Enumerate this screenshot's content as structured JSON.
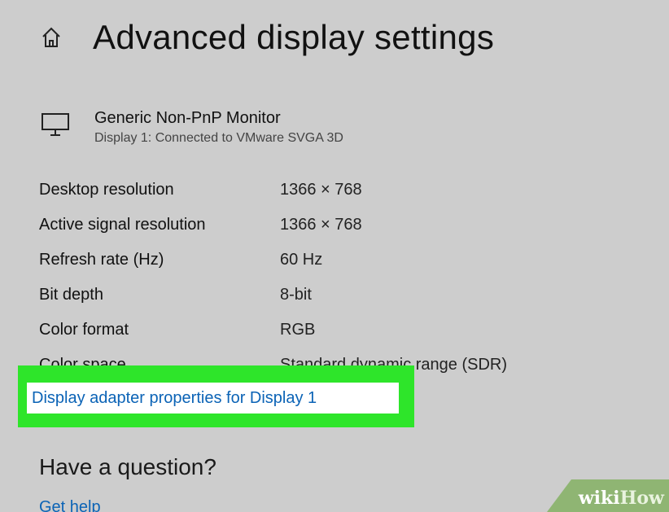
{
  "header": {
    "home_icon": "home-icon",
    "title": "Advanced display settings"
  },
  "monitor": {
    "icon": "monitor-icon",
    "name": "Generic Non-PnP Monitor",
    "subtitle": "Display 1: Connected to VMware SVGA 3D"
  },
  "properties": [
    {
      "label": "Desktop resolution",
      "value": "1366 × 768"
    },
    {
      "label": "Active signal resolution",
      "value": "1366 × 768"
    },
    {
      "label": "Refresh rate (Hz)",
      "value": "60 Hz"
    },
    {
      "label": "Bit depth",
      "value": "8-bit"
    },
    {
      "label": "Color format",
      "value": "RGB"
    },
    {
      "label": "Color space",
      "value": "Standard dynamic range (SDR)"
    }
  ],
  "adapter_link": "Display adapter properties for Display 1",
  "question": {
    "title": "Have a question?",
    "help_link": "Get help"
  },
  "watermark": {
    "wiki": "wiki",
    "how": "How"
  },
  "colors": {
    "background": "#cdcdcd",
    "highlight": "#2ee52a",
    "link": "#0b63b6"
  }
}
